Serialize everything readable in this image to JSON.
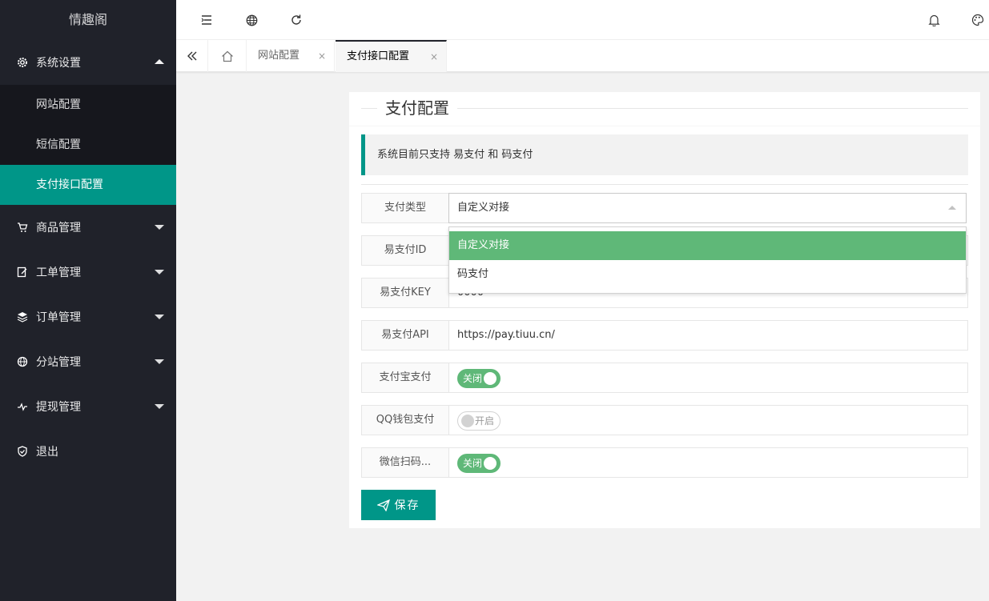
{
  "app": {
    "title": "情趣阁"
  },
  "sidebar": {
    "groups": [
      {
        "label": "系统设置",
        "icon": "gear-icon",
        "open": true,
        "children": [
          {
            "label": "网站配置",
            "active": false
          },
          {
            "label": "短信配置",
            "active": false
          },
          {
            "label": "支付接口配置",
            "active": true
          }
        ]
      },
      {
        "label": "商品管理",
        "icon": "cart-icon"
      },
      {
        "label": "工单管理",
        "icon": "ticket-edit-icon"
      },
      {
        "label": "订单管理",
        "icon": "layers-icon"
      },
      {
        "label": "分站管理",
        "icon": "globe-icon"
      },
      {
        "label": "提现管理",
        "icon": "pulse-icon"
      },
      {
        "label": "退出",
        "icon": "shield-check-icon"
      }
    ]
  },
  "header": {
    "icons": [
      "menu-fold-icon",
      "globe-icon",
      "refresh-icon",
      "bell-icon",
      "palette-icon"
    ]
  },
  "tabs": {
    "items": [
      {
        "label": "网站配置",
        "active": false
      },
      {
        "label": "支付接口配置",
        "active": true
      }
    ],
    "close_glyph": "×"
  },
  "card": {
    "title": "支付配置",
    "notice": "系统目前只支持 易支付 和 码支付",
    "pay_type": {
      "label": "支付类型",
      "value": "自定义对接",
      "options": [
        "自定义对接",
        "码支付"
      ],
      "selected_index": 0
    },
    "epay_id": {
      "label": "易支付ID",
      "value": ""
    },
    "epay_key": {
      "label": "易支付KEY",
      "value": "0000"
    },
    "epay_api": {
      "label": "易支付API",
      "value": "https://pay.tiuu.cn/"
    },
    "alipay": {
      "label": "支付宝支付",
      "switch_text": "关闭",
      "on": true
    },
    "qqpay": {
      "label": "QQ钱包支付",
      "switch_text": "开启",
      "on": false
    },
    "wxpay": {
      "label": "微信扫码...",
      "switch_text": "关闭",
      "on": true
    },
    "save_label": "保存"
  },
  "colors": {
    "accent": "#009688",
    "sidebar_bg": "#20222a",
    "switch_on": "#5fb878"
  }
}
